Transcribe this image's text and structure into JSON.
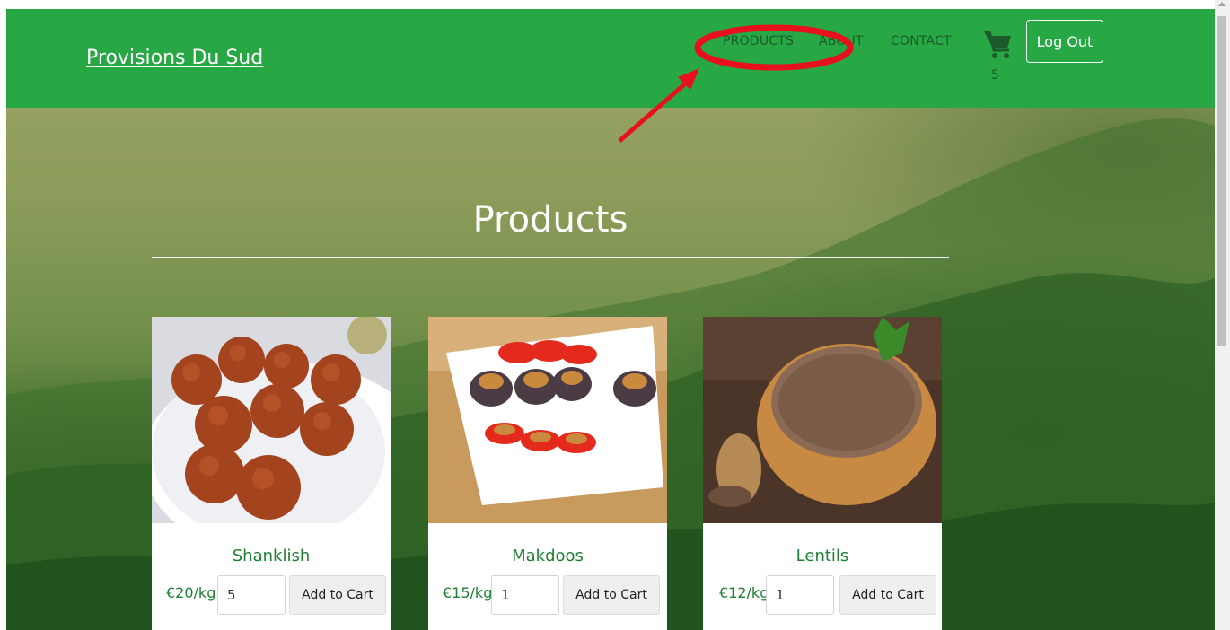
{
  "brand": {
    "name": "Provisions Du Sud"
  },
  "nav": {
    "items": [
      {
        "label": "PRODUCTS"
      },
      {
        "label": "ABOUT"
      },
      {
        "label": "CONTACT"
      }
    ],
    "cart_count": "5",
    "logout_label": "Log Out"
  },
  "page": {
    "title": "Products"
  },
  "products": [
    {
      "name": "Shanklish",
      "price": "€20/kg",
      "quantity": "5",
      "add_label": "Add to Cart"
    },
    {
      "name": "Makdoos",
      "price": "€15/kg",
      "quantity": "1",
      "add_label": "Add to Cart"
    },
    {
      "name": "Lentils",
      "price": "€12/kg",
      "quantity": "1",
      "add_label": "Add to Cart"
    }
  ],
  "colors": {
    "navbar": "#28a745",
    "nav_link": "#1d5a2b",
    "product_name": "#1e7e34",
    "annotation": "#e8101a"
  },
  "icons": {
    "cart": "shopping-cart-icon"
  }
}
